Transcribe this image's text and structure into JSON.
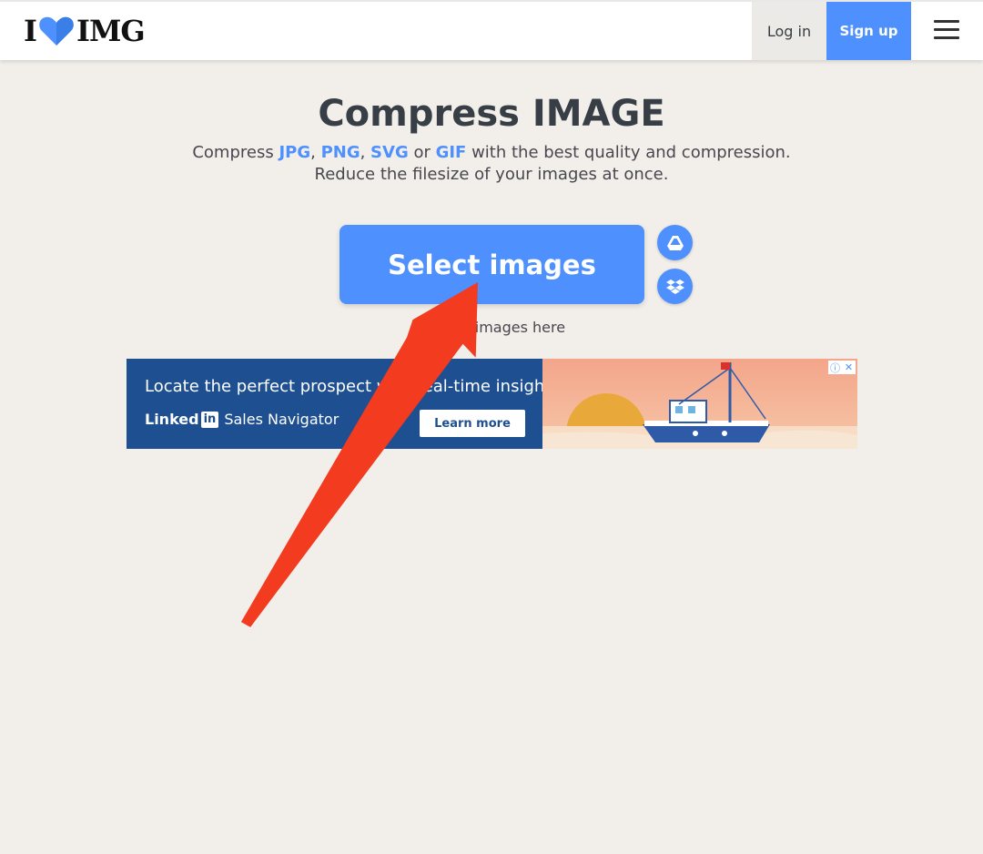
{
  "header": {
    "logo_left": "I",
    "logo_right": "IMG",
    "login_label": "Log in",
    "signup_label": "Sign up"
  },
  "main": {
    "title": "Compress IMAGE",
    "subtitle_prefix": "Compress ",
    "formats": [
      "JPG",
      "PNG",
      "SVG",
      "GIF"
    ],
    "sep_comma": ", ",
    "sep_or": " or ",
    "subtitle_suffix": " with the best quality and compression.",
    "subtitle_line2": "Reduce the filesize of your images at once.",
    "select_label": "Select images",
    "drop_hint": "or drop images here"
  },
  "ad": {
    "headline": "Locate the perfect prospect with real-time insights.",
    "brand": "Linked",
    "brand_in": "in",
    "product": "Sales Navigator",
    "cta": "Learn more"
  },
  "colors": {
    "accent": "#4d90fe",
    "background": "#f2efea",
    "annotation_arrow": "#f23b1f",
    "ad_blue": "#1d4f91"
  },
  "icons": {
    "menu": "hamburger-icon",
    "drive": "google-drive-icon",
    "dropbox": "dropbox-icon",
    "heart": "heart-icon"
  }
}
